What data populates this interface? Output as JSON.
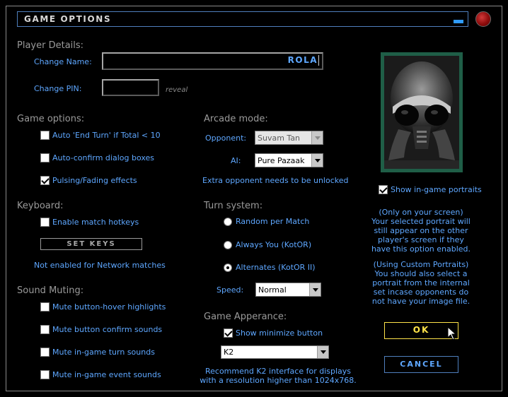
{
  "window": {
    "title": "Game Options"
  },
  "player": {
    "section": "Player Details:",
    "name_label": "Change Name:",
    "name_value": "ROLA",
    "pin_label": "Change PIN:",
    "pin_value": "",
    "reveal": "reveal"
  },
  "game_options": {
    "section": "Game options:",
    "items": [
      {
        "label": "Auto 'End Turn' if Total < 10",
        "checked": false
      },
      {
        "label": "Auto-confirm dialog boxes",
        "checked": false
      },
      {
        "label": "Pulsing/Fading effects",
        "checked": true
      }
    ]
  },
  "keyboard": {
    "section": "Keyboard:",
    "hotkeys_label": "Enable match hotkeys",
    "set_keys": "SET KEYS",
    "note": "Not enabled for Network matches"
  },
  "sound": {
    "section": "Sound Muting:",
    "items": [
      {
        "label": "Mute button-hover highlights",
        "checked": false
      },
      {
        "label": "Mute button confirm sounds",
        "checked": false
      },
      {
        "label": "Mute in-game turn sounds",
        "checked": false
      },
      {
        "label": "Mute in-game event sounds",
        "checked": false
      }
    ]
  },
  "arcade": {
    "section": "Arcade mode:",
    "opponent_label": "Opponent:",
    "opponent_value": "Suvam Tan",
    "ai_label": "AI:",
    "ai_value": "Pure Pazaak",
    "note": "Extra opponent needs to be unlocked"
  },
  "turn": {
    "section": "Turn system:",
    "options": [
      {
        "label": "Random per Match",
        "selected": false
      },
      {
        "label": "Always You (KotOR)",
        "selected": false
      },
      {
        "label": "Alternates (KotOR II)",
        "selected": true
      }
    ],
    "speed_label": "Speed:",
    "speed_value": "Normal"
  },
  "appearance": {
    "section": "Game Apperance:",
    "minimize_label": "Show minimize button",
    "interface_value": "K2",
    "note_line1": "Recommend K2 interface for displays",
    "note_line2": "with a resolution higher than 1024x768."
  },
  "portrait": {
    "show_label": "Show in-game portraits",
    "note1": [
      "(Only on your screen)",
      "Your selected portrait will",
      "still appear on the other",
      "player's screen if they",
      "have this option enabled."
    ],
    "note2": [
      "(Using Custom Portraits)",
      "You should also select a",
      "portrait from the internal",
      "set incase opponents do",
      "not have your image file."
    ]
  },
  "buttons": {
    "ok": "OK",
    "cancel": "CANCEL"
  },
  "colors": {
    "accent_blue": "#5ea7ff",
    "ok_yellow": "#ffe44a",
    "portrait_frame": "#1f5e47",
    "close_red": "#a01010"
  },
  "icons": {
    "close": "red-orb-close-icon",
    "minimize": "minimize-bar-icon",
    "cursor": "arrow-cursor-icon"
  }
}
